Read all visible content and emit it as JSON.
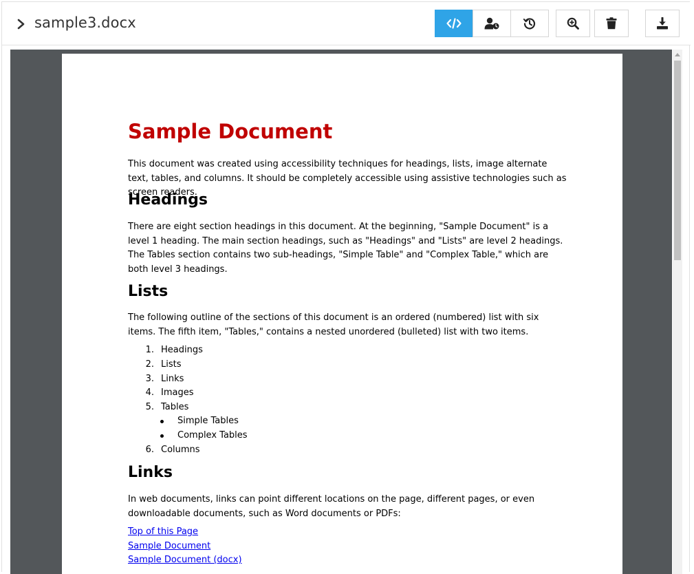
{
  "toolbar": {
    "filename": "sample3.docx",
    "buttons": [
      {
        "name": "source",
        "icon": "code-icon",
        "active": true
      },
      {
        "name": "user",
        "icon": "user-clock-icon",
        "active": false
      },
      {
        "name": "history",
        "icon": "history-icon",
        "active": false
      },
      {
        "name": "zoom",
        "icon": "zoom-in-icon",
        "active": false
      },
      {
        "name": "delete",
        "icon": "trash-icon",
        "active": false
      },
      {
        "name": "download",
        "icon": "download-icon",
        "active": false
      }
    ],
    "accent_color": "#2fa4e7"
  },
  "document": {
    "title": "Sample Document",
    "title_color": "#c00000",
    "intro": "This document was created using accessibility techniques for headings, lists, image alternate text, tables, and columns. It should be completely accessible using assistive technologies such as screen readers.",
    "headings_section": {
      "heading": "Headings",
      "text": "There are eight section headings in this document. At the beginning, \"Sample Document\" is a level 1 heading. The main section headings, such as \"Headings\" and \"Lists\" are level 2 headings. The Tables section contains two sub-headings, \"Simple Table\" and \"Complex Table,\" which are both level 3 headings."
    },
    "lists_section": {
      "heading": "Lists",
      "text": "The following outline of the sections of this document is an ordered (numbered) list with six items. The fifth item, \"Tables,\" contains a nested unordered (bulleted) list with two items.",
      "items": [
        {
          "num": "1.",
          "label": "Headings"
        },
        {
          "num": "2.",
          "label": "Lists"
        },
        {
          "num": "3.",
          "label": "Links"
        },
        {
          "num": "4.",
          "label": "Images"
        },
        {
          "num": "5.",
          "label": "Tables"
        },
        {
          "num": "6.",
          "label": "Columns"
        }
      ],
      "sub_items": [
        "Simple Tables",
        "Complex Tables"
      ]
    },
    "links_section": {
      "heading": "Links",
      "text": "In web documents, links can point different locations on the page, different pages, or even downloadable documents, such as Word documents or PDFs:",
      "links": [
        "Top of this Page",
        "Sample Document",
        "Sample Document (docx)"
      ]
    }
  }
}
